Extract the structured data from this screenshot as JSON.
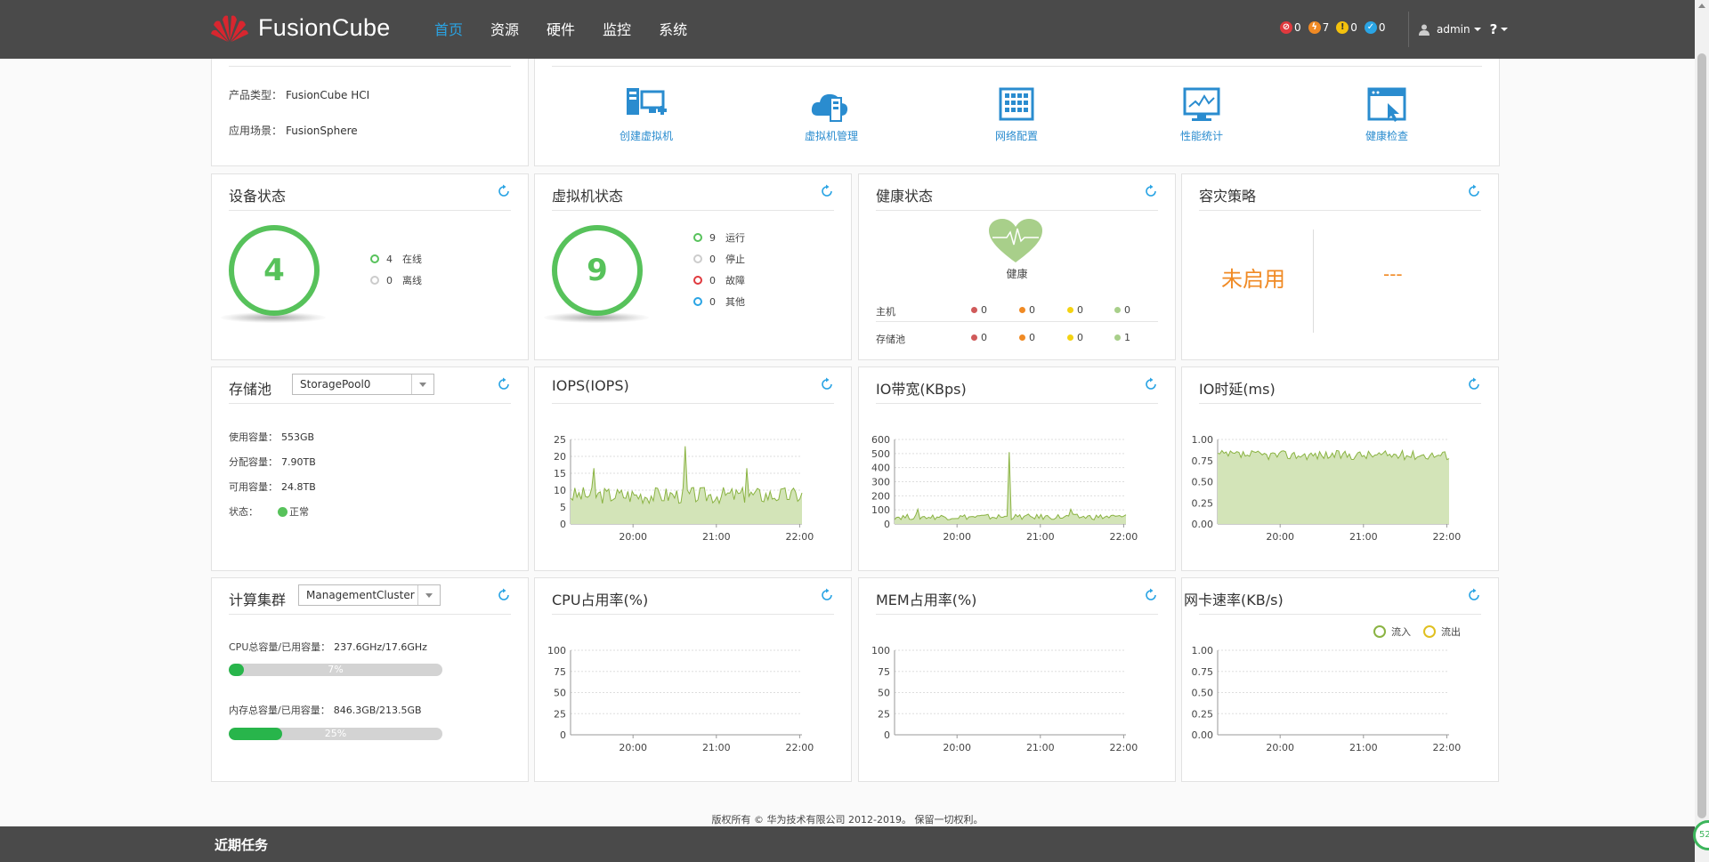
{
  "app": {
    "name": "FusionCube"
  },
  "nav": {
    "items": [
      "首页",
      "资源",
      "硬件",
      "监控",
      "系统"
    ],
    "active": 0
  },
  "alarms": [
    {
      "icon": "critical-alarm-icon",
      "count": "0",
      "color": "#e0393e"
    },
    {
      "icon": "major-alarm-icon",
      "count": "7",
      "color": "#f08a24"
    },
    {
      "icon": "minor-alarm-icon",
      "count": "0",
      "color": "#f4c20d"
    },
    {
      "icon": "warning-alarm-icon",
      "count": "0",
      "color": "#2aa4e4"
    }
  ],
  "user": {
    "name": "admin",
    "help": "?"
  },
  "product": {
    "type_label": "产品类型：",
    "type_value": "FusionCube HCI",
    "scene_label": "应用场景：",
    "scene_value": "FusionSphere"
  },
  "quick_actions": [
    {
      "label": "创建虚拟机",
      "icon": "create-vm-icon"
    },
    {
      "label": "虚拟机管理",
      "icon": "vm-management-icon"
    },
    {
      "label": "网络配置",
      "icon": "network-config-icon"
    },
    {
      "label": "性能统计",
      "icon": "performance-stats-icon"
    },
    {
      "label": "健康检查",
      "icon": "health-check-icon"
    }
  ],
  "device_status": {
    "title": "设备状态",
    "total": "4",
    "legend": [
      {
        "count": "4",
        "label": "在线",
        "color": "#57c25b"
      },
      {
        "count": "0",
        "label": "离线",
        "color": "#cccccc"
      }
    ]
  },
  "vm_status": {
    "title": "虚拟机状态",
    "total": "9",
    "legend": [
      {
        "count": "9",
        "label": "运行",
        "color": "#57c25b"
      },
      {
        "count": "0",
        "label": "停止",
        "color": "#cccccc"
      },
      {
        "count": "0",
        "label": "故障",
        "color": "#e0393e"
      },
      {
        "count": "0",
        "label": "其他",
        "color": "#2aa4e4"
      }
    ]
  },
  "health_status": {
    "title": "健康状态",
    "status": "健康",
    "rows": [
      {
        "label": "主机",
        "values": [
          "0",
          "0",
          "0",
          "0"
        ]
      },
      {
        "label": "存储池",
        "values": [
          "0",
          "0",
          "0",
          "1"
        ]
      }
    ],
    "colors": [
      "#d05a5a",
      "#f08a24",
      "#f4d312",
      "#a8cf8a"
    ]
  },
  "dr_policy": {
    "title": "容灾策略",
    "status": "未启用",
    "value": "---"
  },
  "storage_pool": {
    "title": "存储池",
    "selected": "StoragePool0",
    "rows": [
      {
        "label": "使用容量：",
        "value": "553GB"
      },
      {
        "label": "分配容量：",
        "value": "7.90TB"
      },
      {
        "label": "可用容量：",
        "value": "24.8TB"
      }
    ],
    "state_label": "状态：",
    "state_value": "正常",
    "state_color": "#57c25b"
  },
  "compute_cluster": {
    "title": "计算集群",
    "selected": "ManagementCluster",
    "cpu_label": "CPU总容量/已用容量：",
    "cpu_value": "237.6GHz/17.6GHz",
    "cpu_percent": 7,
    "cpu_percent_text": "7%",
    "mem_label": "内存总容量/已用容量：",
    "mem_value": "846.3GB/213.5GB",
    "mem_percent": 25,
    "mem_percent_text": "25%"
  },
  "legend_inout": {
    "in": "流入",
    "out": "流出",
    "in_color": "#8ab342",
    "out_color": "#e0c020"
  },
  "footer": {
    "copyright": "版权所有 © 华为技术有限公司 2012-2019。 保留一切权利。"
  },
  "bottombar": {
    "title": "近期任务"
  },
  "corner_badge": "52",
  "chart_data": [
    {
      "id": "iops",
      "type": "area",
      "title": "IOPS(IOPS)",
      "ylim": [
        0,
        25
      ],
      "yticks": [
        "0",
        "5",
        "10",
        "15",
        "20",
        "25"
      ],
      "xticks": [
        "20:00",
        "21:00",
        "22:00"
      ],
      "fill": "#d3e4b8",
      "stroke": "#8ab342",
      "spike_at": "20:25",
      "spike_value": 23,
      "typical_range": [
        6,
        11
      ]
    },
    {
      "id": "bw",
      "type": "area",
      "title": "IO带宽(KBps)",
      "ylim": [
        0,
        600
      ],
      "yticks": [
        "0",
        "100",
        "200",
        "300",
        "400",
        "500",
        "600"
      ],
      "xticks": [
        "20:00",
        "21:00",
        "22:00"
      ],
      "fill": "#d3e4b8",
      "stroke": "#8ab342",
      "spike_at": "20:25",
      "spike_value": 510,
      "typical_range": [
        30,
        70
      ]
    },
    {
      "id": "lat",
      "type": "area",
      "title": "IO时延(ms)",
      "ylim": [
        0,
        1
      ],
      "yticks": [
        "0.00",
        "0.25",
        "0.50",
        "0.75",
        "1.00"
      ],
      "xticks": [
        "20:00",
        "21:00",
        "22:00"
      ],
      "fill": "#d3e4b8",
      "stroke": "#8ab342",
      "typical_range": [
        0.76,
        0.87
      ]
    },
    {
      "id": "cpu",
      "type": "line",
      "title": "CPU占用率(%)",
      "ylim": [
        0,
        100
      ],
      "yticks": [
        "0",
        "25",
        "50",
        "75",
        "100"
      ],
      "xticks": [
        "20:00",
        "21:00",
        "22:00"
      ],
      "values": []
    },
    {
      "id": "mem",
      "type": "line",
      "title": "MEM占用率(%)",
      "ylim": [
        0,
        100
      ],
      "yticks": [
        "0",
        "25",
        "50",
        "75",
        "100"
      ],
      "xticks": [
        "20:00",
        "21:00",
        "22:00"
      ],
      "values": []
    },
    {
      "id": "nic",
      "type": "line",
      "title": "网卡速率(KB/s)",
      "ylim": [
        0,
        1
      ],
      "yticks": [
        "0.00",
        "0.25",
        "0.50",
        "0.75",
        "1.00"
      ],
      "xticks": [
        "20:00",
        "21:00",
        "22:00"
      ],
      "series": [
        {
          "name": "流入",
          "values": []
        },
        {
          "name": "流出",
          "values": []
        }
      ]
    }
  ]
}
